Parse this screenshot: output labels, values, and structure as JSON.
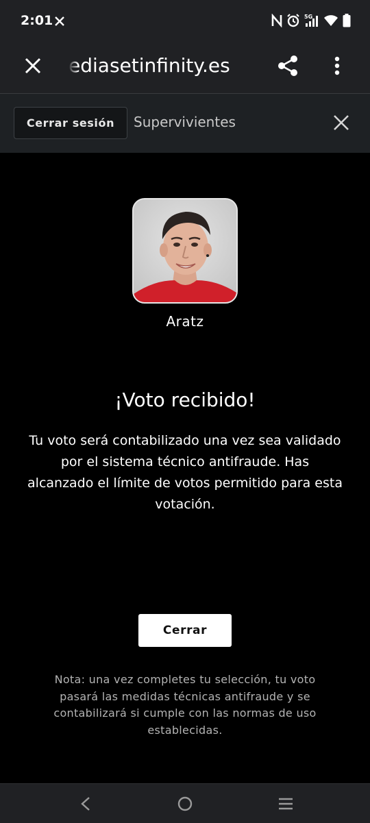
{
  "status_bar": {
    "time": "2:01",
    "network": "5G",
    "icons": [
      "x-app-icon",
      "nfc-icon",
      "alarm-icon",
      "signal-icon",
      "wifi-icon",
      "battery-icon"
    ]
  },
  "browser": {
    "url": "ediasetinfinity.es",
    "icons": [
      "close-icon",
      "share-icon",
      "more-vert-icon"
    ]
  },
  "header": {
    "logout_label": "Cerrar sesión",
    "title": "Supervivientes"
  },
  "candidate": {
    "name": "Aratz"
  },
  "confirmation": {
    "title": "¡Voto recibido!",
    "message": "Tu voto será contabilizado una vez sea validado por el sistema técnico antifraude. Has alcanzado el límite de votos permitido para esta votación.",
    "close_label": "Cerrar",
    "note": "Nota: una vez completes tu selección, tu voto pasará las medidas técnicas antifraude y se contabilizará si cumple con las normas de uso establecidas."
  },
  "nav_bar": {
    "icons": [
      "back-icon",
      "home-icon",
      "recents-icon"
    ]
  },
  "colors": {
    "background": "#000000",
    "toolbar": "#202124",
    "header": "#1e2124",
    "button_primary": "#ffffff",
    "note_text": "#b3b3b3",
    "shirt_red": "#d0202a"
  }
}
